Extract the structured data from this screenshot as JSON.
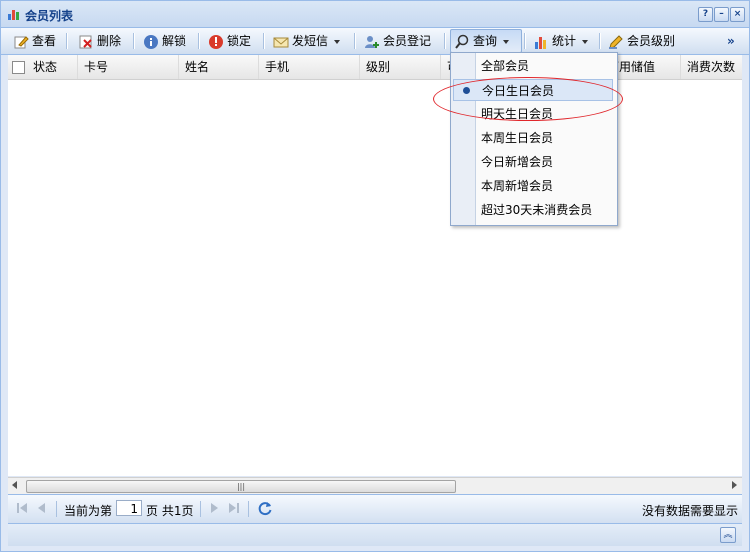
{
  "window": {
    "title": "会员列表",
    "buttons": [
      "?",
      "–",
      "×"
    ]
  },
  "toolbar": {
    "view": "查看",
    "delete": "删除",
    "unlock": "解锁",
    "lock": "锁定",
    "sms": "发短信",
    "register": "会员登记",
    "query": "查询",
    "stats": "统计",
    "level": "会员级别",
    "more": "»"
  },
  "grid": {
    "columns": [
      "状态",
      "卡号",
      "姓名",
      "手机",
      "级别",
      "可",
      "可用储值",
      "消费次数"
    ]
  },
  "menu": {
    "items": [
      {
        "label": "全部会员",
        "checked": false
      },
      {
        "label": "今日生日会员",
        "checked": true
      },
      {
        "label": "明天生日会员",
        "checked": false
      },
      {
        "label": "本周生日会员",
        "checked": false
      },
      {
        "label": "今日新增会员",
        "checked": false
      },
      {
        "label": "本周新增会员",
        "checked": false
      },
      {
        "label": "超过30天未消费会员",
        "checked": false
      }
    ]
  },
  "pager": {
    "before": "当前为第",
    "page": "1",
    "after": "页 共1页",
    "message": "没有数据需要显示"
  },
  "colors": {
    "accent": "#15428b",
    "border": "#99bbe8",
    "highlight": "#e0262b"
  }
}
